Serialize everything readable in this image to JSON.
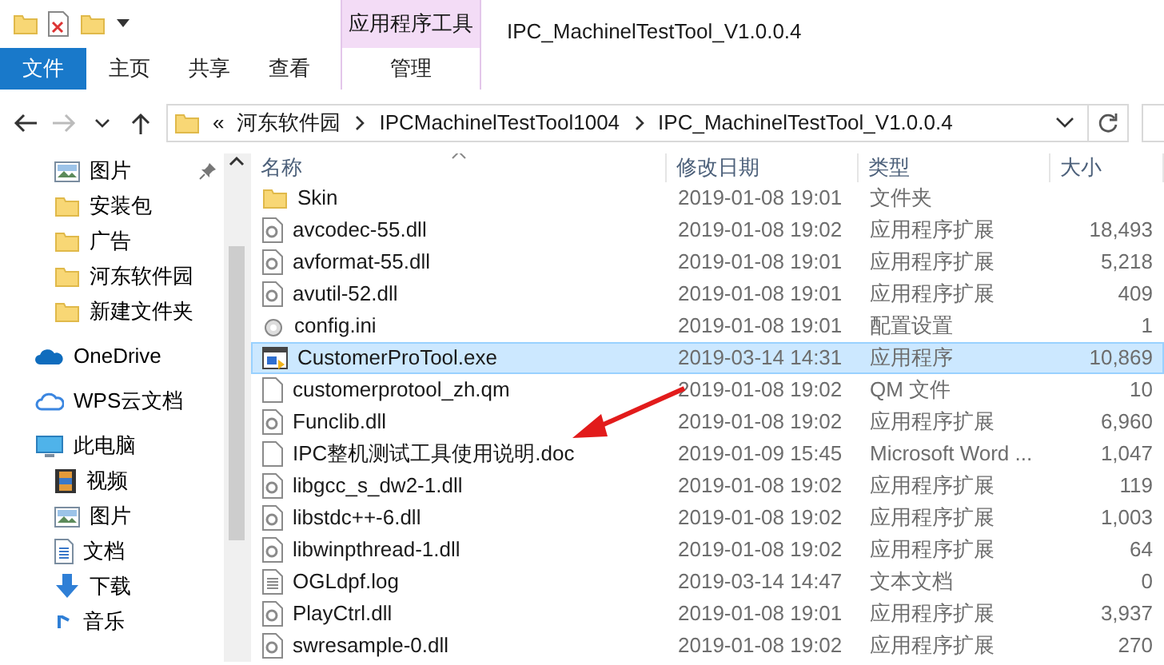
{
  "window": {
    "title": "IPC_MachinelTestTool_V1.0.0.4"
  },
  "context_tab_group": {
    "label": "应用程序工具"
  },
  "ribbon_tabs": [
    {
      "label": "文件",
      "kind": "file"
    },
    {
      "label": "主页",
      "kind": "normal"
    },
    {
      "label": "共享",
      "kind": "normal"
    },
    {
      "label": "查看",
      "kind": "normal"
    },
    {
      "label": "管理",
      "kind": "context"
    }
  ],
  "address_bar": {
    "overflow": "«",
    "path": [
      "河东软件园",
      "IPCMachinelTestTool1004",
      "IPC_MachinelTestTool_V1.0.0.4"
    ]
  },
  "navigation": {
    "quick_access_items": [
      {
        "label": "图片",
        "kind": "pictures",
        "pinned": true
      },
      {
        "label": "安装包",
        "kind": "folder",
        "pinned": false
      },
      {
        "label": "广告",
        "kind": "folder",
        "pinned": false
      },
      {
        "label": "河东软件园",
        "kind": "folder",
        "pinned": false
      },
      {
        "label": "新建文件夹",
        "kind": "folder",
        "pinned": false
      }
    ],
    "items": [
      {
        "label": "OneDrive",
        "kind": "onedrive"
      },
      {
        "label": "WPS云文档",
        "kind": "cloud"
      },
      {
        "label": "此电脑",
        "kind": "pc",
        "children": [
          {
            "label": "视频",
            "kind": "videos"
          },
          {
            "label": "图片",
            "kind": "pictures"
          },
          {
            "label": "文档",
            "kind": "documents"
          },
          {
            "label": "下载",
            "kind": "downloads"
          },
          {
            "label": "音乐",
            "kind": "music"
          }
        ]
      }
    ]
  },
  "columns": [
    {
      "label": "名称",
      "sorted": true
    },
    {
      "label": "修改日期",
      "sorted": false
    },
    {
      "label": "类型",
      "sorted": false
    },
    {
      "label": "大小",
      "sorted": false
    }
  ],
  "files": [
    {
      "name": "Skin",
      "modified": "2019-01-08 19:01",
      "type": "文件夹",
      "kind": "folder",
      "selected": false
    },
    {
      "name": "avcodec-55.dll",
      "modified": "2019-01-08 19:02",
      "type": "应用程序扩展",
      "size": "18,493",
      "kind": "dll",
      "selected": false
    },
    {
      "name": "avformat-55.dll",
      "modified": "2019-01-08 19:01",
      "type": "应用程序扩展",
      "size": "5,218",
      "kind": "dll",
      "selected": false
    },
    {
      "name": "avutil-52.dll",
      "modified": "2019-01-08 19:01",
      "type": "应用程序扩展",
      "size": "409",
      "kind": "dll",
      "selected": false
    },
    {
      "name": "config.ini",
      "modified": "2019-01-08 19:01",
      "type": "配置设置",
      "size": "1",
      "kind": "ini",
      "selected": false
    },
    {
      "name": "CustomerProTool.exe",
      "modified": "2019-03-14 14:31",
      "type": "应用程序",
      "size": "10,869",
      "kind": "exe",
      "selected": true
    },
    {
      "name": "customerprotool_zh.qm",
      "modified": "2019-01-08 19:02",
      "type": "QM 文件",
      "size": "10",
      "kind": "file",
      "selected": false
    },
    {
      "name": "Funclib.dll",
      "modified": "2019-01-08 19:02",
      "type": "应用程序扩展",
      "size": "6,960",
      "kind": "dll",
      "selected": false
    },
    {
      "name": "IPC整机测试工具使用说明.doc",
      "modified": "2019-01-09 15:45",
      "type": "Microsoft Word ...",
      "size": "1,047",
      "kind": "file",
      "selected": false
    },
    {
      "name": "libgcc_s_dw2-1.dll",
      "modified": "2019-01-08 19:02",
      "type": "应用程序扩展",
      "size": "119",
      "kind": "dll",
      "selected": false
    },
    {
      "name": "libstdc++-6.dll",
      "modified": "2019-01-08 19:02",
      "type": "应用程序扩展",
      "size": "1,003",
      "kind": "dll",
      "selected": false
    },
    {
      "name": "libwinpthread-1.dll",
      "modified": "2019-01-08 19:02",
      "type": "应用程序扩展",
      "size": "64",
      "kind": "dll",
      "selected": false
    },
    {
      "name": "OGLdpf.log",
      "modified": "2019-03-14 14:47",
      "type": "文本文档",
      "size": "0",
      "kind": "log",
      "selected": false
    },
    {
      "name": "PlayCtrl.dll",
      "modified": "2019-01-08 19:01",
      "type": "应用程序扩展",
      "size": "3,937",
      "kind": "dll",
      "selected": false
    },
    {
      "name": "swresample-0.dll",
      "modified": "2019-01-08 19:02",
      "type": "应用程序扩展",
      "size": "270",
      "kind": "dll",
      "selected": false
    }
  ]
}
